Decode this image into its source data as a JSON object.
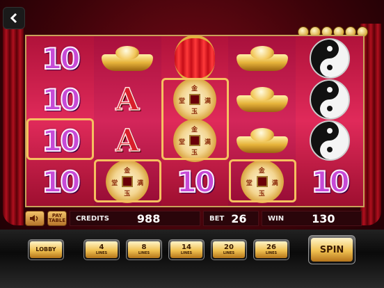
{
  "hud": {
    "sound_icon": "speaker-icon",
    "paytable_label": "PAY TABLE",
    "credits_label": "CREDITS",
    "credits_value": "988",
    "bet_label": "BET",
    "bet_value": "26",
    "win_label": "WIN",
    "win_value": "130"
  },
  "reels": [
    [
      "10",
      "10",
      "10",
      "10"
    ],
    [
      "gold-ingot",
      "A",
      "A",
      "lucky-coin"
    ],
    [
      "red-lantern",
      "lucky-coin",
      "lucky-coin",
      "10"
    ],
    [
      "gold-ingot",
      "gold-ingot",
      "gold-ingot",
      "lucky-coin"
    ],
    [
      "yin-yang",
      "yin-yang",
      "yin-yang",
      "10"
    ]
  ],
  "symbols": {
    "ten": "10",
    "ace": "A"
  },
  "coin_chars": [
    "金",
    "满",
    "玉",
    "堂"
  ],
  "buttons": {
    "lobby": "LOBBY",
    "lines": [
      {
        "num": "4",
        "sub": "LINES"
      },
      {
        "num": "8",
        "sub": "LINES"
      },
      {
        "num": "14",
        "sub": "LINES"
      },
      {
        "num": "20",
        "sub": "LINES"
      },
      {
        "num": "26",
        "sub": "LINES"
      }
    ],
    "spin": "SPIN"
  },
  "jackpot_coins": 6,
  "colors": {
    "reel_bg": "#c8184a",
    "gold": "#f0c050",
    "frame": "#c9a25a"
  }
}
